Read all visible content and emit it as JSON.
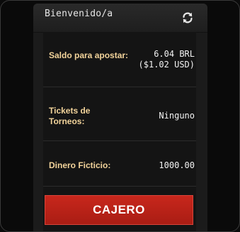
{
  "header": {
    "title": "Bienvenido/a",
    "refresh_icon": "refresh-icon"
  },
  "balance": {
    "label": "Saldo para apostar:",
    "value_primary": "6.04 BRL",
    "value_secondary": "($1.02 USD)"
  },
  "tournament_tickets": {
    "label_line1": "Tickets de",
    "label_line2": "Torneos:",
    "value": "Ninguno"
  },
  "play_money": {
    "label": "Dinero Ficticio:",
    "value": "1000.00"
  },
  "cashier_button": {
    "label": "CAJERO"
  },
  "colors": {
    "label": "#f2d39a",
    "value": "#f3f3f3",
    "button": "#c8271c"
  }
}
